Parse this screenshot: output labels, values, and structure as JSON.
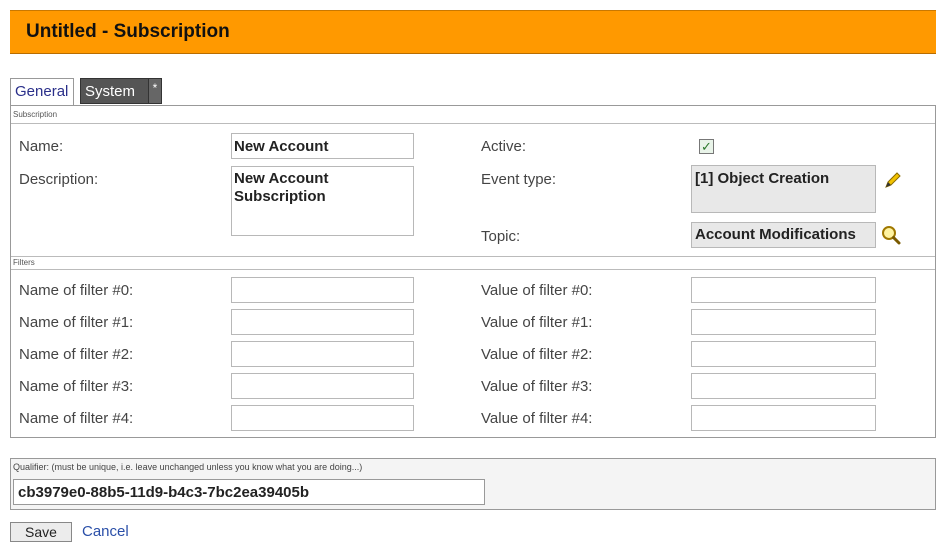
{
  "window": {
    "title": "Untitled - Subscription"
  },
  "tabs": [
    {
      "label": "General"
    },
    {
      "label": "System"
    },
    {
      "label": "*"
    }
  ],
  "subscription": {
    "section_label": "Subscription",
    "name_label": "Name:",
    "name_value": "New Account",
    "description_label": "Description:",
    "description_value": "New Account\nSubscription",
    "active_label": "Active:",
    "active_checked": true,
    "event_type_label": "Event type:",
    "event_type_value": "[1] Object Creation",
    "topic_label": "Topic:",
    "topic_value": "Account Modifications"
  },
  "filters": {
    "section_label": "Filters",
    "rows": [
      {
        "name_label": "Name of filter #0:",
        "value_label": "Value of filter #0:",
        "name_value": "",
        "value_value": ""
      },
      {
        "name_label": "Name of filter #1:",
        "value_label": "Value of filter #1:",
        "name_value": "",
        "value_value": ""
      },
      {
        "name_label": "Name of filter #2:",
        "value_label": "Value of filter #2:",
        "name_value": "",
        "value_value": ""
      },
      {
        "name_label": "Name of filter #3:",
        "value_label": "Value of filter #3:",
        "name_value": "",
        "value_value": ""
      },
      {
        "name_label": "Name of filter #4:",
        "value_label": "Value of filter #4:",
        "name_value": "",
        "value_value": ""
      }
    ]
  },
  "qualifier": {
    "label": "Qualifier: (must be unique, i.e. leave unchanged unless you know what you are doing...)",
    "value": "cb3979e0-88b5-11d9-b4c3-7bc2ea39405b"
  },
  "actions": {
    "save_label": "Save",
    "cancel_label": "Cancel"
  },
  "colors": {
    "title_bar": "#ff9900",
    "link": "#2a4fa8",
    "check": "#2d7a2d"
  },
  "icons": {
    "edit": "pencil-icon",
    "search": "magnifier-icon"
  }
}
